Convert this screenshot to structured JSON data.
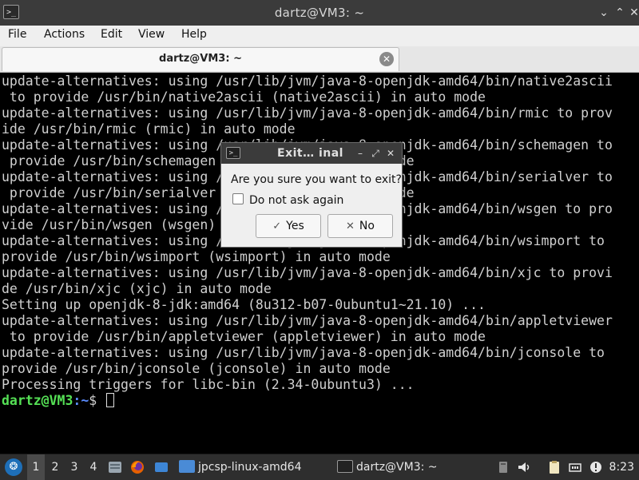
{
  "window": {
    "title": "dartz@VM3: ~",
    "minimize_glyph": "⌄",
    "maximize_glyph": "⌃",
    "close_glyph": "✕",
    "icon_glyph": ">_"
  },
  "menubar": {
    "items": [
      "File",
      "Actions",
      "Edit",
      "View",
      "Help"
    ]
  },
  "tab": {
    "label": "dartz@VM3: ~",
    "close_glyph": "✕"
  },
  "terminal": {
    "lines": [
      "update-alternatives: using /usr/lib/jvm/java-8-openjdk-amd64/bin/native2ascii",
      " to provide /usr/bin/native2ascii (native2ascii) in auto mode",
      "update-alternatives: using /usr/lib/jvm/java-8-openjdk-amd64/bin/rmic to prov",
      "ide /usr/bin/rmic (rmic) in auto mode",
      "update-alternatives: using /usr/lib/jvm/java-8-openjdk-amd64/bin/schemagen to",
      " provide /usr/bin/schemagen (schemagen) in auto mode",
      "update-alternatives: using /usr/lib/jvm/java-8-openjdk-amd64/bin/serialver to",
      " provide /usr/bin/serialver (serialver) in auto mode",
      "update-alternatives: using /usr/lib/jvm/java-8-openjdk-amd64/bin/wsgen to pro",
      "vide /usr/bin/wsgen (wsgen) in auto mode",
      "update-alternatives: using /usr/lib/jvm/java-8-openjdk-amd64/bin/wsimport to",
      "provide /usr/bin/wsimport (wsimport) in auto mode",
      "update-alternatives: using /usr/lib/jvm/java-8-openjdk-amd64/bin/xjc to provi",
      "de /usr/bin/xjc (xjc) in auto mode",
      "Setting up openjdk-8-jdk:amd64 (8u312-b07-0ubuntu1~21.10) ...",
      "update-alternatives: using /usr/lib/jvm/java-8-openjdk-amd64/bin/appletviewer",
      " to provide /usr/bin/appletviewer (appletviewer) in auto mode",
      "update-alternatives: using /usr/lib/jvm/java-8-openjdk-amd64/bin/jconsole to",
      "provide /usr/bin/jconsole (jconsole) in auto mode",
      "Processing triggers for libc-bin (2.34-0ubuntu3) ..."
    ],
    "prompt_user": "dartz@VM3",
    "prompt_path": ":~",
    "prompt_symbol": "$ ",
    "text_color": "#d0d0d0",
    "prompt_user_color": "#55e055",
    "prompt_path_color": "#5a8cff"
  },
  "dialog": {
    "title": "Exit…  inal",
    "message": "Are you sure you want to exit?",
    "checkbox_label": "Do not ask again",
    "checkbox_checked": false,
    "yes_label": "Yes",
    "yes_glyph": "✓",
    "no_label": "No",
    "no_glyph": "✕",
    "min_glyph": "–",
    "max_glyph": "⤢",
    "close_glyph": "✕",
    "icon_glyph": ">_"
  },
  "taskbar": {
    "start_glyph": "❂",
    "workspaces": [
      "1",
      "2",
      "3",
      "4"
    ],
    "active_workspace": "1",
    "tasks": [
      {
        "label": "jpcsp-linux-amd64",
        "icon": "folder-icon"
      },
      {
        "label": "dartz@VM3: ~",
        "icon": "terminal-icon"
      }
    ],
    "clock": "8:23",
    "accent": "#1e6fb8"
  }
}
